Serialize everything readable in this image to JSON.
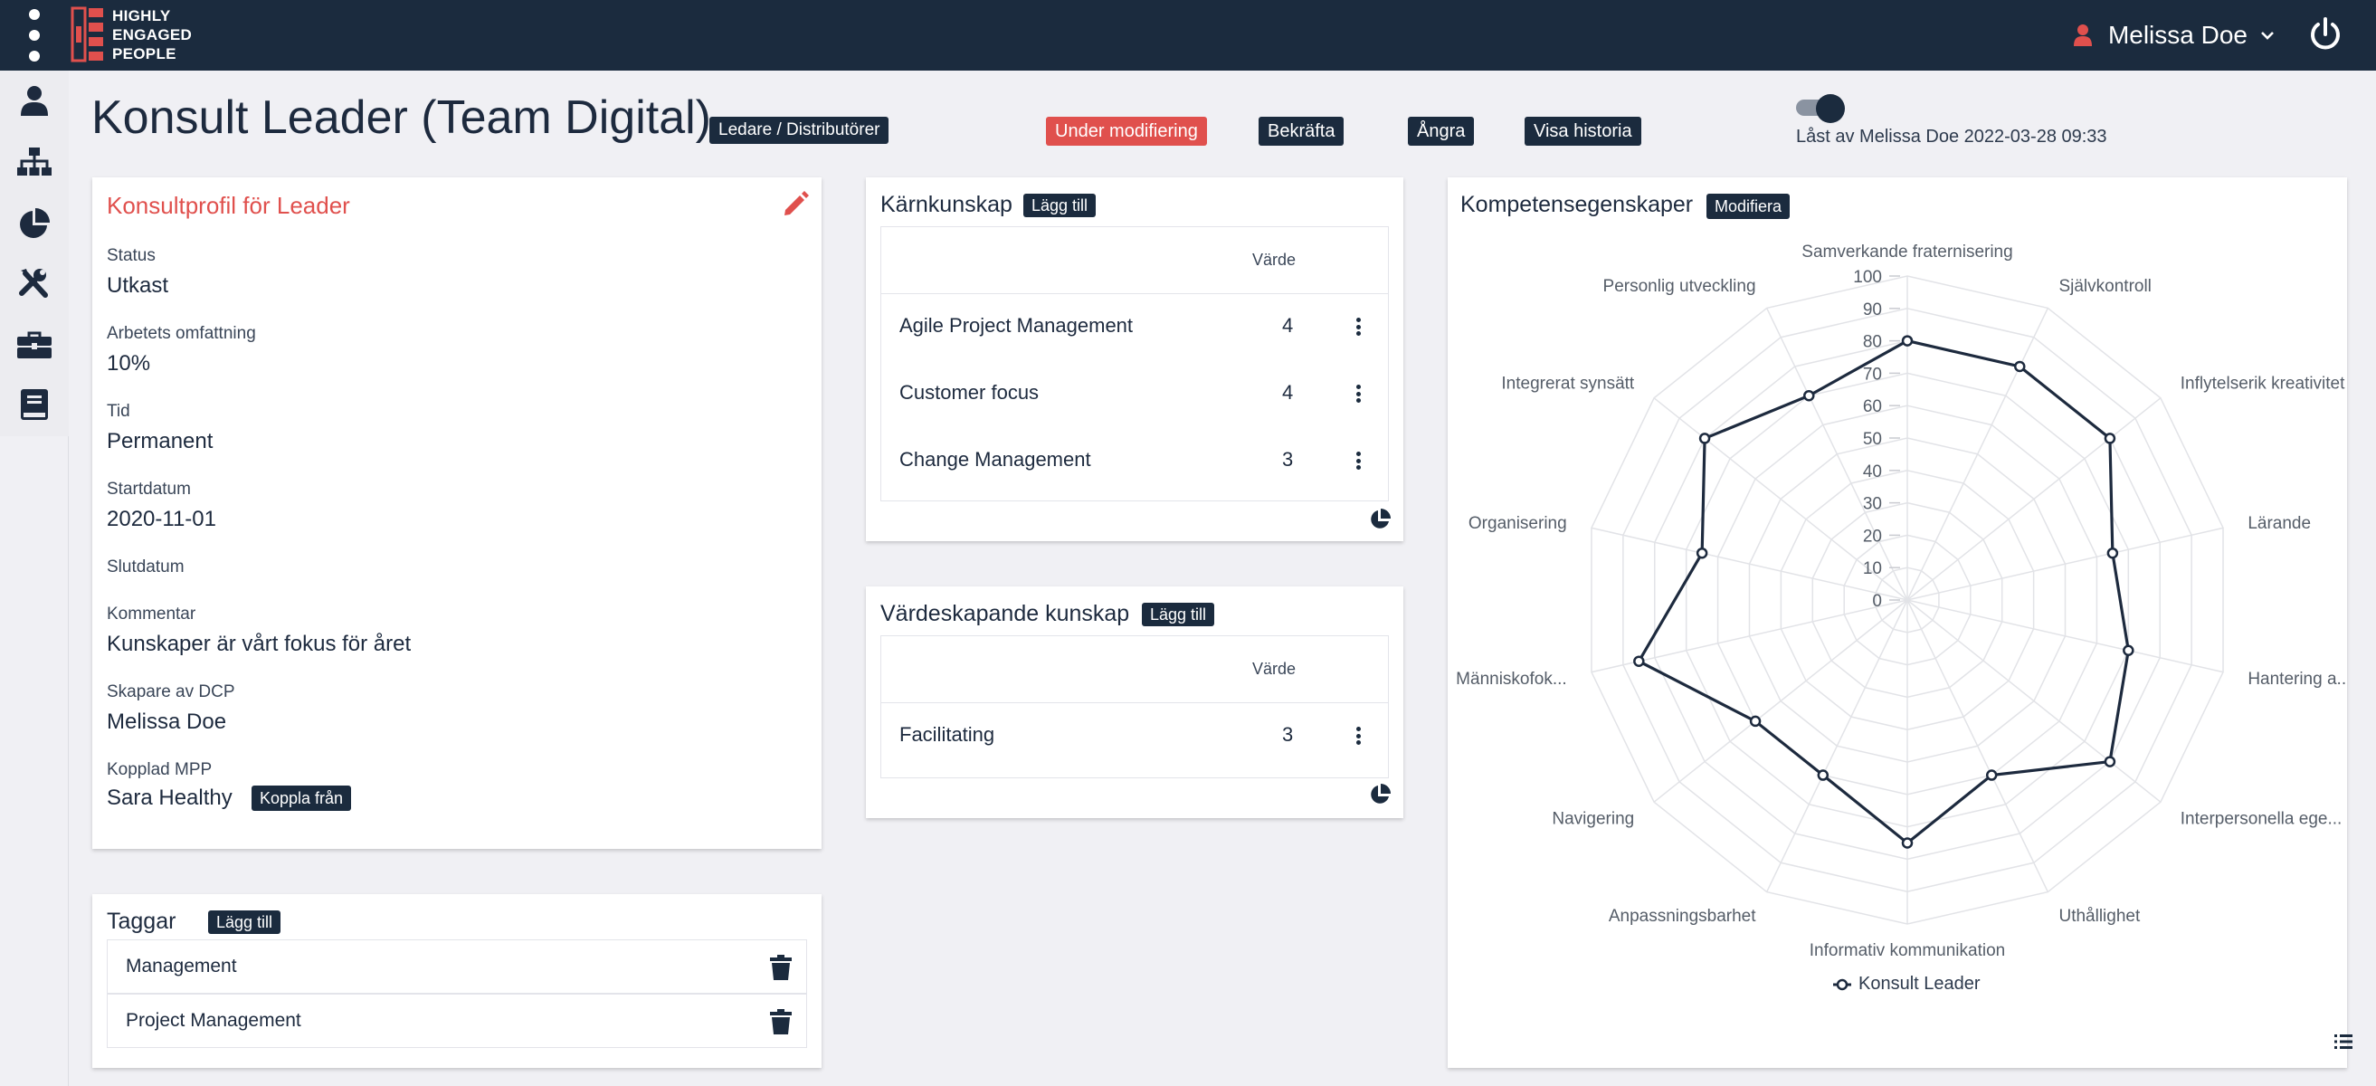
{
  "brand": {
    "logo_lines": [
      "HIGHLY",
      "ENGAGED",
      "PEOPLE"
    ]
  },
  "user": {
    "name": "Melissa Doe"
  },
  "header": {
    "title": "Konsult Leader (Team Digital)",
    "tag": "Ledare / Distributörer",
    "status_chip": "Under modifiering",
    "confirm": "Bekräfta",
    "undo": "Ångra",
    "history": "Visa historia",
    "lock_text": "Låst av Melissa Doe 2022-03-28 09:33"
  },
  "profile": {
    "title": "Konsultprofil för Leader",
    "fields": [
      {
        "label": "Status",
        "value": "Utkast"
      },
      {
        "label": "Arbetets omfattning",
        "value": "10%"
      },
      {
        "label": "Tid",
        "value": "Permanent"
      },
      {
        "label": "Startdatum",
        "value": "2020-11-01"
      },
      {
        "label": "Slutdatum",
        "value": ""
      },
      {
        "label": "Kommentar",
        "value": "Kunskaper är vårt fokus för året"
      },
      {
        "label": "Skapare av DCP",
        "value": "Melissa Doe"
      },
      {
        "label": "Kopplad MPP",
        "value": "Sara Healthy"
      }
    ],
    "unlink": "Koppla från"
  },
  "tags": {
    "title": "Taggar",
    "add": "Lägg till",
    "items": [
      "Management",
      "Project Management"
    ]
  },
  "core": {
    "title": "Kärnkunskap",
    "add": "Lägg till",
    "col_value": "Värde",
    "rows": [
      {
        "name": "Agile Project Management",
        "value": "4"
      },
      {
        "name": "Customer focus",
        "value": "4"
      },
      {
        "name": "Change Management",
        "value": "3"
      }
    ]
  },
  "value_creating": {
    "title": "Värdeskapande kunskap",
    "add": "Lägg till",
    "col_value": "Värde",
    "rows": [
      {
        "name": "Facilitating",
        "value": "3"
      }
    ]
  },
  "competence": {
    "title": "Kompetensegenskaper",
    "modify": "Modifiera",
    "legend": "Konsult Leader",
    "line_color": "#1d2a3e"
  },
  "chart_data": {
    "type": "radar",
    "title": "",
    "categories": [
      "Samverkande fraternisering",
      "Självkontroll",
      "Inflytelserik kreativitet",
      "Lärande",
      "Hantering a...",
      "Interpersonella ege...",
      "Uthållighet",
      "Informativ kommunikation",
      "Anpassningsbarhet",
      "Navigering",
      "Människofok...",
      "Organisering",
      "Integrerat synsätt",
      "Personlig utveckling"
    ],
    "ticks": [
      "0",
      "10",
      "20",
      "30",
      "40",
      "50",
      "60",
      "70",
      "80",
      "90",
      "100"
    ],
    "ylim": [
      0,
      100
    ],
    "series": [
      {
        "name": "Konsult Leader",
        "values": [
          80,
          80,
          80,
          65,
          70,
          80,
          60,
          75,
          60,
          60,
          85,
          65,
          80,
          70
        ]
      }
    ],
    "legend_position": "bottom"
  }
}
